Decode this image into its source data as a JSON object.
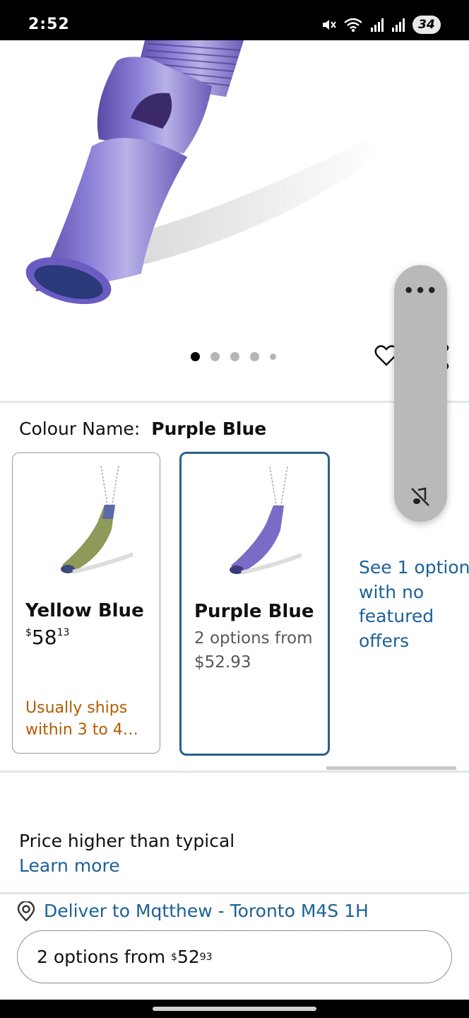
{
  "status_bar": {
    "time": "2:52",
    "battery": "34",
    "icons": [
      "mute-icon",
      "wifi-icon",
      "signal-icon",
      "signal-icon",
      "battery-icon"
    ]
  },
  "gallery": {
    "image_count": 5,
    "active_index": 0,
    "product_color": "#7b6fc4"
  },
  "variation": {
    "label": "Colour Name:",
    "selected": "Purple Blue"
  },
  "options": [
    {
      "name": "Yellow Blue",
      "price_symbol": "$",
      "price_whole": "58",
      "price_fraction": "13",
      "shipping": "Usually ships within 3 to 4…",
      "selected": false
    },
    {
      "name": "Purple Blue",
      "sub_line1": "2 options from",
      "sub_line2": "$52.93",
      "selected": true
    }
  ],
  "see_option": "See 1 option\nwith no\nfeatured\noffers",
  "price_note": "Price higher than typical",
  "learn_more": "Learn more",
  "deliver": "Deliver to Mqtthew - Toronto M4S 1H",
  "options_button": {
    "prefix": "2 options from ",
    "price_symbol": "$",
    "price_whole": "52",
    "price_fraction": "93"
  },
  "side_widget": {
    "more": "•••",
    "icons": [
      "more-icon",
      "sound-off-icon"
    ]
  },
  "colors": {
    "link": "#1c6196",
    "selected_border": "#2a5f8f",
    "shipping": "#b35c00"
  }
}
